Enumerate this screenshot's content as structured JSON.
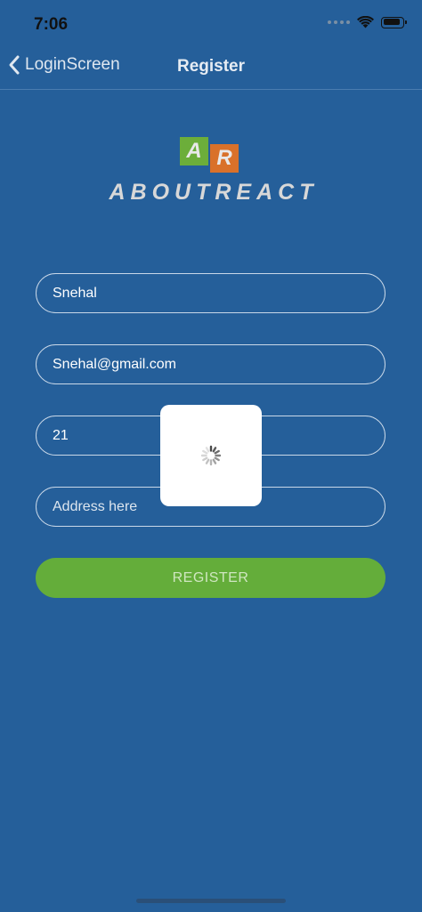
{
  "status_bar": {
    "time": "7:06"
  },
  "nav": {
    "back_label": "LoginScreen",
    "title": "Register"
  },
  "logo": {
    "mark_left": "A",
    "mark_right": "R",
    "text": "ABOUTREACT"
  },
  "form": {
    "name_value": "Snehal",
    "email_value": "Snehal@gmail.com",
    "age_value": "21",
    "address_placeholder": "Address here",
    "register_label": "REGISTER"
  },
  "colors": {
    "background": "#255f9a",
    "button": "#64ad3a",
    "logo_green": "#6cae3a",
    "logo_orange": "#d9712a"
  },
  "icons": {
    "back": "chevron-left-icon",
    "wifi": "wifi-icon",
    "battery": "battery-icon",
    "loader": "spinner-icon"
  }
}
